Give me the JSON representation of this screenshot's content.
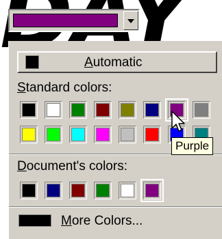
{
  "background_text": "DAY",
  "picker": {
    "selected_color": "#800080"
  },
  "automatic": {
    "label_underlined": "A",
    "label_rest": "utomatic",
    "swatch_color": "#000000"
  },
  "standard": {
    "label_underlined": "S",
    "label_rest": "tandard colors:",
    "colors": [
      [
        "#000000",
        "#ffffff",
        "#008000",
        "#800000",
        "#808000",
        "#000080",
        "#800080",
        "#808080"
      ],
      [
        "#ffff00",
        "#00ff00",
        "#00ffff",
        "#ff00ff",
        "#c0c0c0",
        "#ff0000",
        "#0000ff",
        "#008080"
      ]
    ],
    "selected": "#800080"
  },
  "document": {
    "label_underlined": "D",
    "label_rest": "ocument's colors:",
    "colors": [
      "#000000",
      "#000080",
      "#800000",
      "#008000",
      "#ffffff",
      "#800080"
    ],
    "selected": "#800080"
  },
  "more": {
    "label_underlined": "M",
    "label_rest": "ore Colors...",
    "swatch_color": "#000000"
  },
  "tooltip": {
    "text": "Purple"
  },
  "icons": {
    "dropdown": "chevron-down-icon",
    "cursor": "arrow-cursor-icon"
  }
}
